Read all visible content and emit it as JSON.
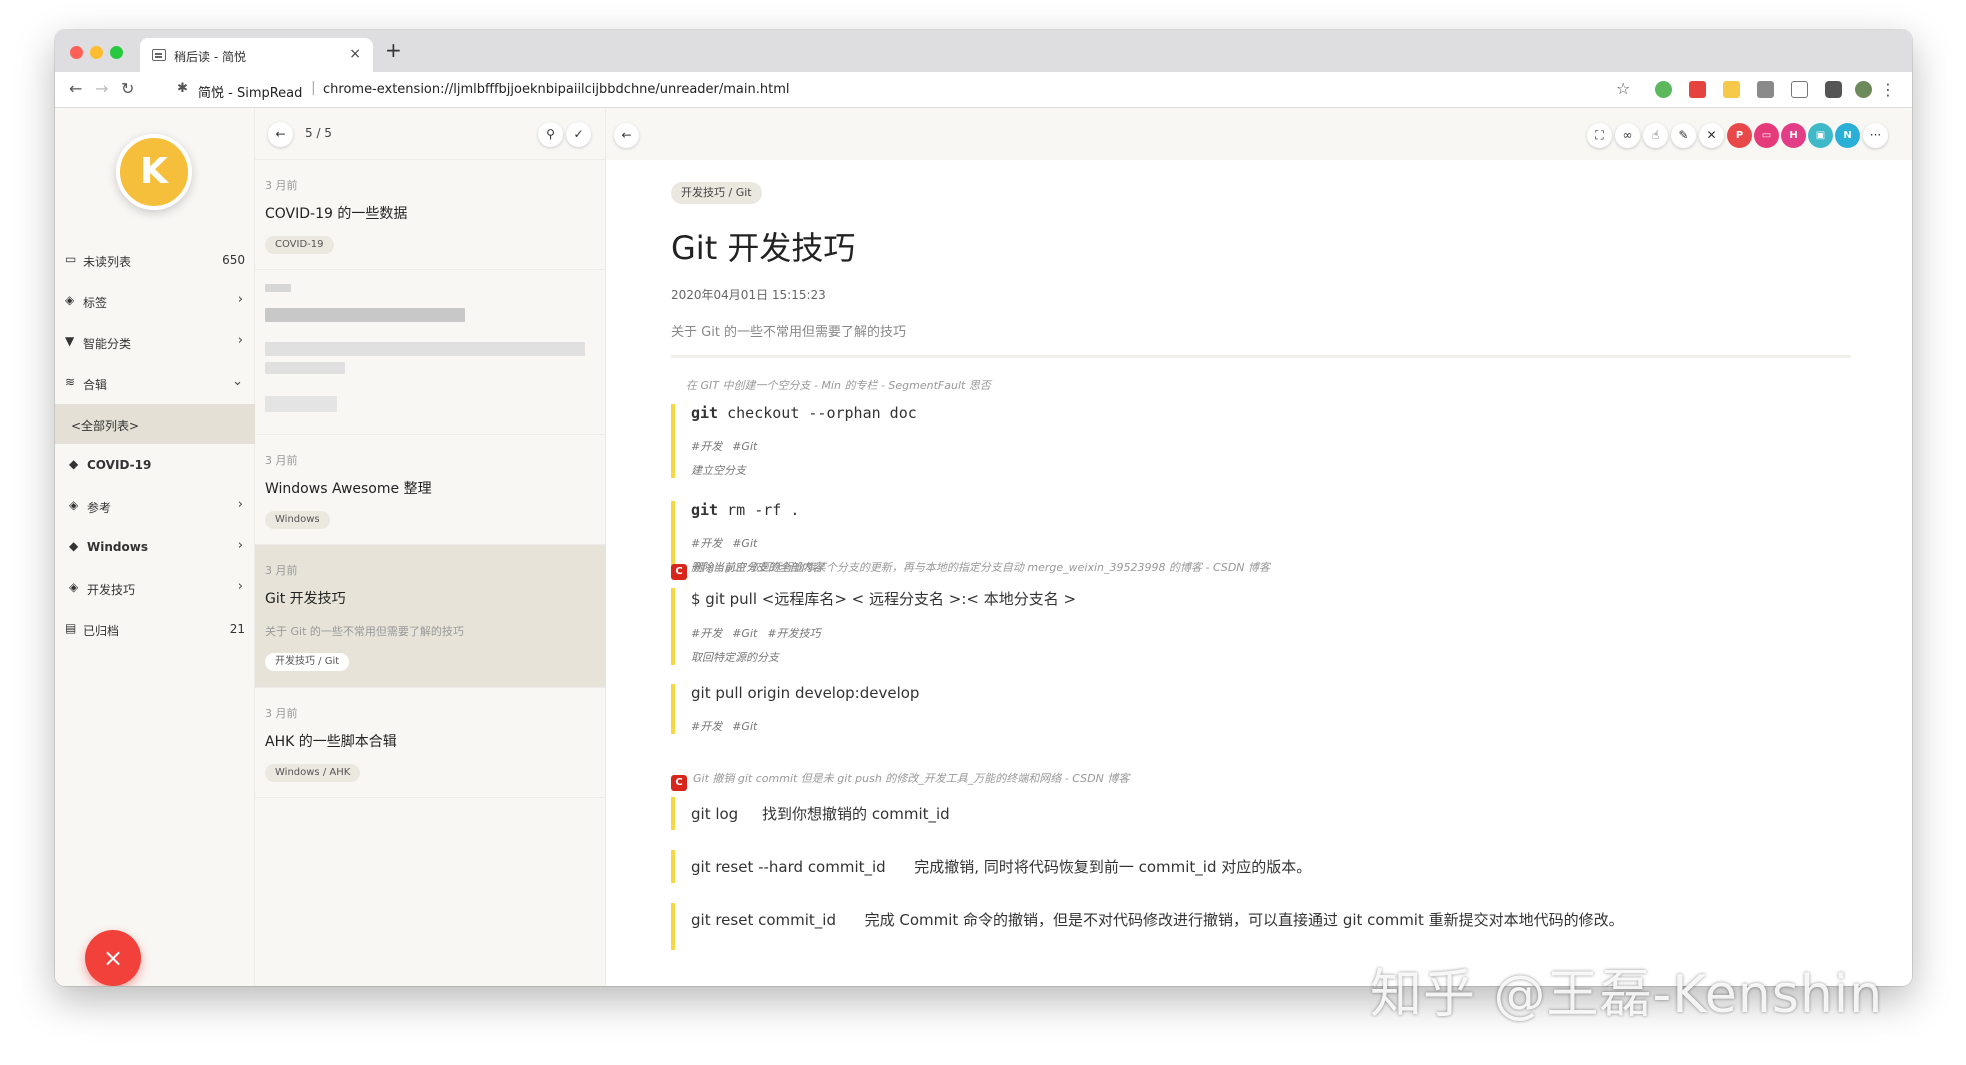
{
  "browser": {
    "tab_title": "稍后读 - 简悦",
    "tab_close": "×",
    "new_tab": "+",
    "site_name": "简悦 - SimpRead",
    "url": "chrome-extension://ljmlbfffbjjoeknbipaiilcijbbdchne/unreader/main.html"
  },
  "sidebar": {
    "avatar_letter": "K",
    "items": [
      {
        "icon": "inbox-icon",
        "label": "未读列表",
        "count": "650"
      },
      {
        "icon": "tags-icon",
        "label": "标签",
        "chevron": "›"
      },
      {
        "icon": "filter-icon",
        "label": "智能分类",
        "chevron": "›"
      },
      {
        "icon": "stack-icon",
        "label": "合辑",
        "chevron": "⌄"
      },
      {
        "label": "<全部列表>"
      },
      {
        "icon": "tag-icon",
        "label": "COVID-19"
      },
      {
        "icon": "tags-icon",
        "label": "参考",
        "chevron": "›"
      },
      {
        "icon": "tag-icon",
        "label": "Windows",
        "chevron": "›"
      },
      {
        "icon": "tags-icon",
        "label": "开发技巧",
        "chevron": "›"
      },
      {
        "icon": "archive-icon",
        "label": "已归档",
        "count": "21"
      }
    ],
    "fab": "×"
  },
  "list": {
    "pager": "5 / 5",
    "cards": [
      {
        "time": "3 月前",
        "title": "COVID-19 的一些数据",
        "chip": "COVID-19"
      },
      {
        "time": "3 月前",
        "title": "Windows Awesome 整理",
        "chip": "Windows"
      },
      {
        "time": "3 月前",
        "title": "Git 开发技巧",
        "desc": "关于 Git 的一些不常用但需要了解的技巧",
        "chip": "开发技巧 / Git"
      },
      {
        "time": "3 月前",
        "title": "AHK 的一些脚本合辑",
        "chip": "Windows / AHK"
      }
    ]
  },
  "article": {
    "category": "开发技巧 / Git",
    "title": "Git 开发技巧",
    "date": "2020年04月01日 15:15:23",
    "desc": "关于 Git 的一些不常用但需要了解的技巧",
    "source1": "在 GIT 中创建一个空分支 - Min 的专栏 - SegmentFault 思否",
    "q1_cmd": "git",
    "q1_rest": " checkout --orphan doc",
    "q1_tag1": "#开发",
    "q1_tag2": "#Git",
    "q1_note": "建立空分支",
    "q2_cmd": "git",
    "q2_rest": " rm -rf .",
    "q2_tag1": "#开发",
    "q2_tag2": "#Git",
    "q2_note": "删除当前空分支的全部内容",
    "source2_badge": "C",
    "source2": "用 git pull 取回远程仓库某个分支的更新，再与本地的指定分支自动 merge_weixin_39523998 的博客 - CSDN 博客",
    "q3_text": "$ git pull <远程库名> < 远程分支名 >:< 本地分支名 >",
    "q3_tag1": "#开发",
    "q3_tag2": "#Git",
    "q3_tag3": "#开发技巧",
    "q3_note": "取回特定源的分支",
    "q4_text": "git pull origin develop:develop",
    "q4_tag1": "#开发",
    "q4_tag2": "#Git",
    "source3_badge": "C",
    "source3": "Git 撤销 git commit 但是未 git push 的修改_开发工具_万能的终端和网络 - CSDN 博客",
    "q5_text": "git log     找到你想撤销的 commit_id",
    "q6_text": "git reset --hard commit_id      完成撤销, 同时将代码恢复到前一 commit_id 对应的版本。",
    "q7_text": "git reset commit_id      完成 Commit 命令的撤销，但是不对代码修改进行撤销，可以直接通过 git commit 重新提交对本地代码的修改。"
  },
  "watermark": "知乎 @王磊-Kenshin",
  "colors": {
    "accent_yellow": "#f5d742",
    "avatar": "#f6bf3b",
    "fab_red": "#f2403a",
    "selected_card": "#e7e3d8"
  }
}
